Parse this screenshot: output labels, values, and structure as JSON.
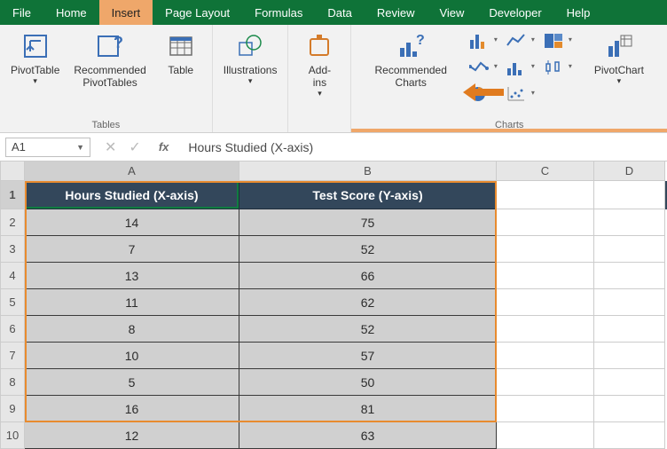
{
  "menus": [
    "File",
    "Home",
    "Insert",
    "Page Layout",
    "Formulas",
    "Data",
    "Review",
    "View",
    "Developer",
    "Help"
  ],
  "active_menu": "Insert",
  "ribbon": {
    "pivottable": "PivotTable",
    "rec_pivot": "Recommended\nPivotTables",
    "table": "Table",
    "illustrations": "Illustrations",
    "addins": "Add-\nins",
    "rec_charts": "Recommended\nCharts",
    "pivotchart": "PivotChart",
    "group_tables": "Tables",
    "group_charts": "Charts"
  },
  "namebox": "A1",
  "formula": "Hours Studied (X-axis)",
  "columns": [
    "A",
    "B",
    "C",
    "D"
  ],
  "headers": {
    "a": "Hours Studied (X-axis)",
    "b": "Test Score (Y-axis)"
  },
  "rows": [
    {
      "a": "14",
      "b": "75"
    },
    {
      "a": "7",
      "b": "52"
    },
    {
      "a": "13",
      "b": "66"
    },
    {
      "a": "11",
      "b": "62"
    },
    {
      "a": "8",
      "b": "52"
    },
    {
      "a": "10",
      "b": "57"
    },
    {
      "a": "5",
      "b": "50"
    },
    {
      "a": "16",
      "b": "81"
    },
    {
      "a": "12",
      "b": "63"
    }
  ],
  "chart_data": {
    "type": "table",
    "xlabel": "Hours Studied (X-axis)",
    "ylabel": "Test Score (Y-axis)",
    "x": [
      14,
      7,
      13,
      11,
      8,
      10,
      5,
      16,
      12
    ],
    "y": [
      75,
      52,
      66,
      62,
      52,
      57,
      50,
      81,
      63
    ]
  }
}
